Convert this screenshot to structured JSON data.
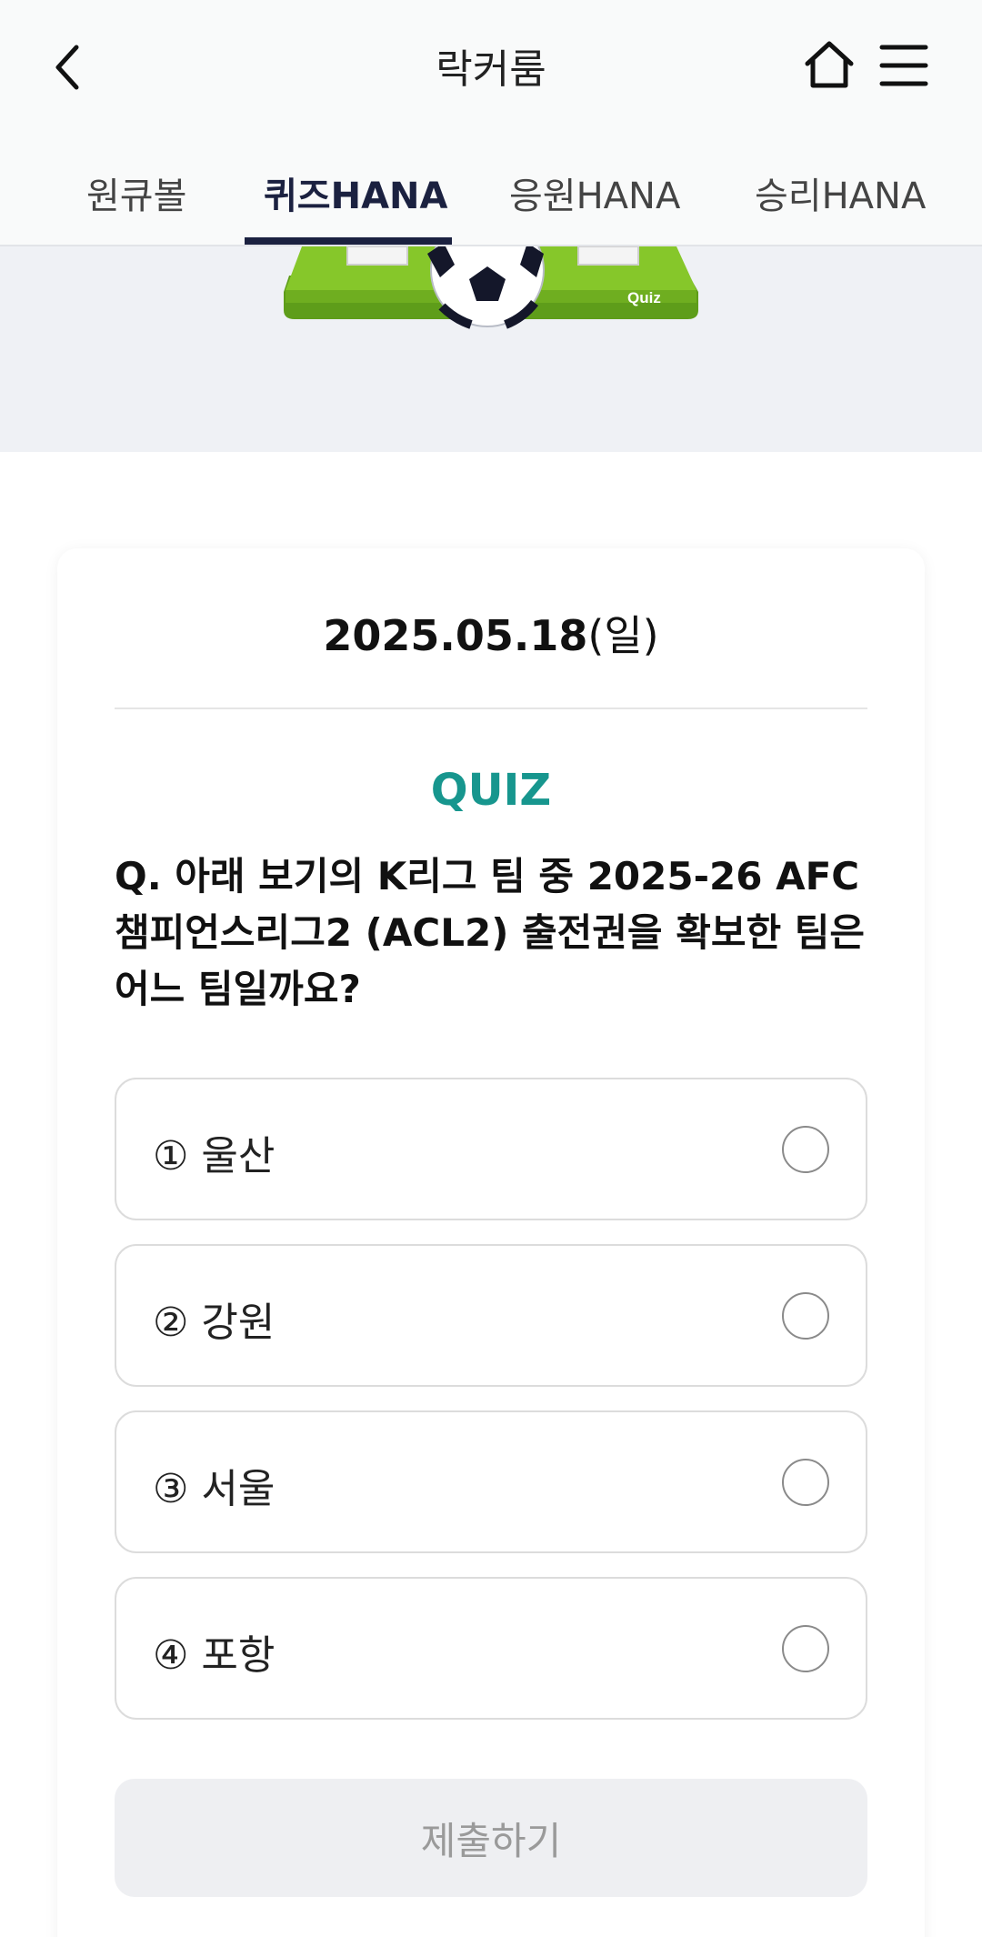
{
  "header": {
    "title": "락커룸",
    "back_icon": "chevron-left-icon",
    "home_icon": "home-icon",
    "menu_icon": "hamburger-menu-icon"
  },
  "tabs": [
    {
      "label": "원큐볼"
    },
    {
      "label": "퀴즈HANA",
      "active": true
    },
    {
      "label": "응원HANA"
    },
    {
      "label": "승리HANA"
    }
  ],
  "banner": {
    "quiz_sign": "Quiz"
  },
  "card": {
    "date": "2025.05.18",
    "day": "(일)",
    "quiz_label": "QUIZ",
    "question": "Q. 아래 보기의 K리그 팀 중 2025-26 AFC 챔피언스리그2 (ACL2) 출전권을 확보한 팀은 어느 팀일까요?",
    "options": [
      {
        "label": "① 울산"
      },
      {
        "label": "② 강원"
      },
      {
        "label": "③ 서울"
      },
      {
        "label": "④ 포항"
      }
    ],
    "submit_label": "제출하기"
  },
  "colors": {
    "accent": "#17968e",
    "tab_active": "#1b2140",
    "banner_bg": "#eff1f5",
    "field_green": "#7cc324"
  }
}
